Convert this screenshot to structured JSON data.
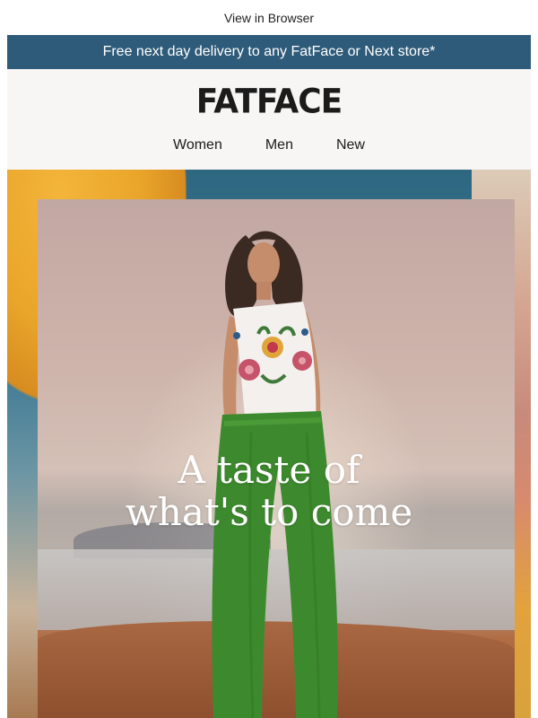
{
  "top_link": "View in Browser",
  "promo": "Free next day delivery to any FatFace or Next store*",
  "brand": {
    "logo_text": "FATFACE"
  },
  "nav": [
    "Women",
    "Men",
    "New"
  ],
  "hero": {
    "title_line1": "A taste of",
    "title_line2": "what's to come"
  },
  "colors": {
    "promo_bg": "#2f5b7a",
    "header_bg": "#f8f6f4",
    "pants": "#3d8a2e"
  }
}
